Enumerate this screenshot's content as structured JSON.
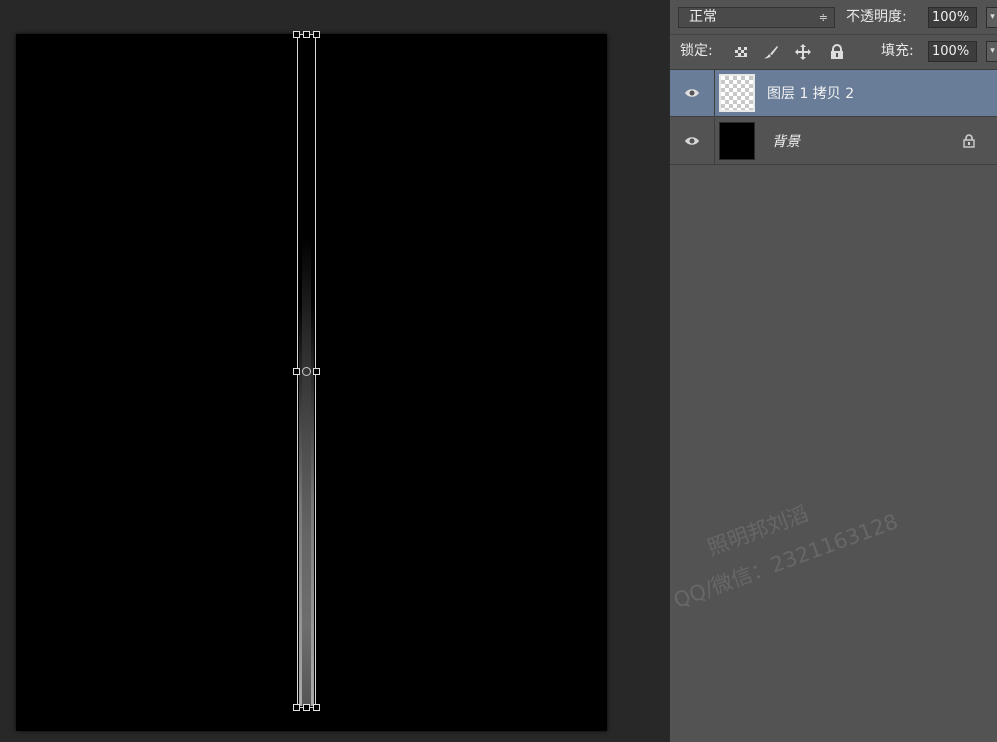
{
  "layers_panel": {
    "blend_mode": "正常",
    "blend_arrow": "≑",
    "opacity_label": "不透明度:",
    "opacity_value": "100%",
    "lock_label": "锁定:",
    "fill_label": "填充:",
    "fill_value": "100%",
    "dropdown_arrow": "▾",
    "layers": [
      {
        "name": "图层 1 拷贝 2",
        "visible": true,
        "selected": true,
        "thumbnail": "transparent"
      },
      {
        "name": "背景",
        "visible": true,
        "selected": false,
        "thumbnail": "black",
        "locked": true
      }
    ]
  },
  "watermark": {
    "line1": "照明邦刘滔",
    "line2": "QQ/微信：2321163128"
  },
  "colors": {
    "selected_row": "#697d98",
    "panel_bg": "#535353",
    "workspace_bg": "#282828",
    "canvas_bg": "#000000"
  }
}
